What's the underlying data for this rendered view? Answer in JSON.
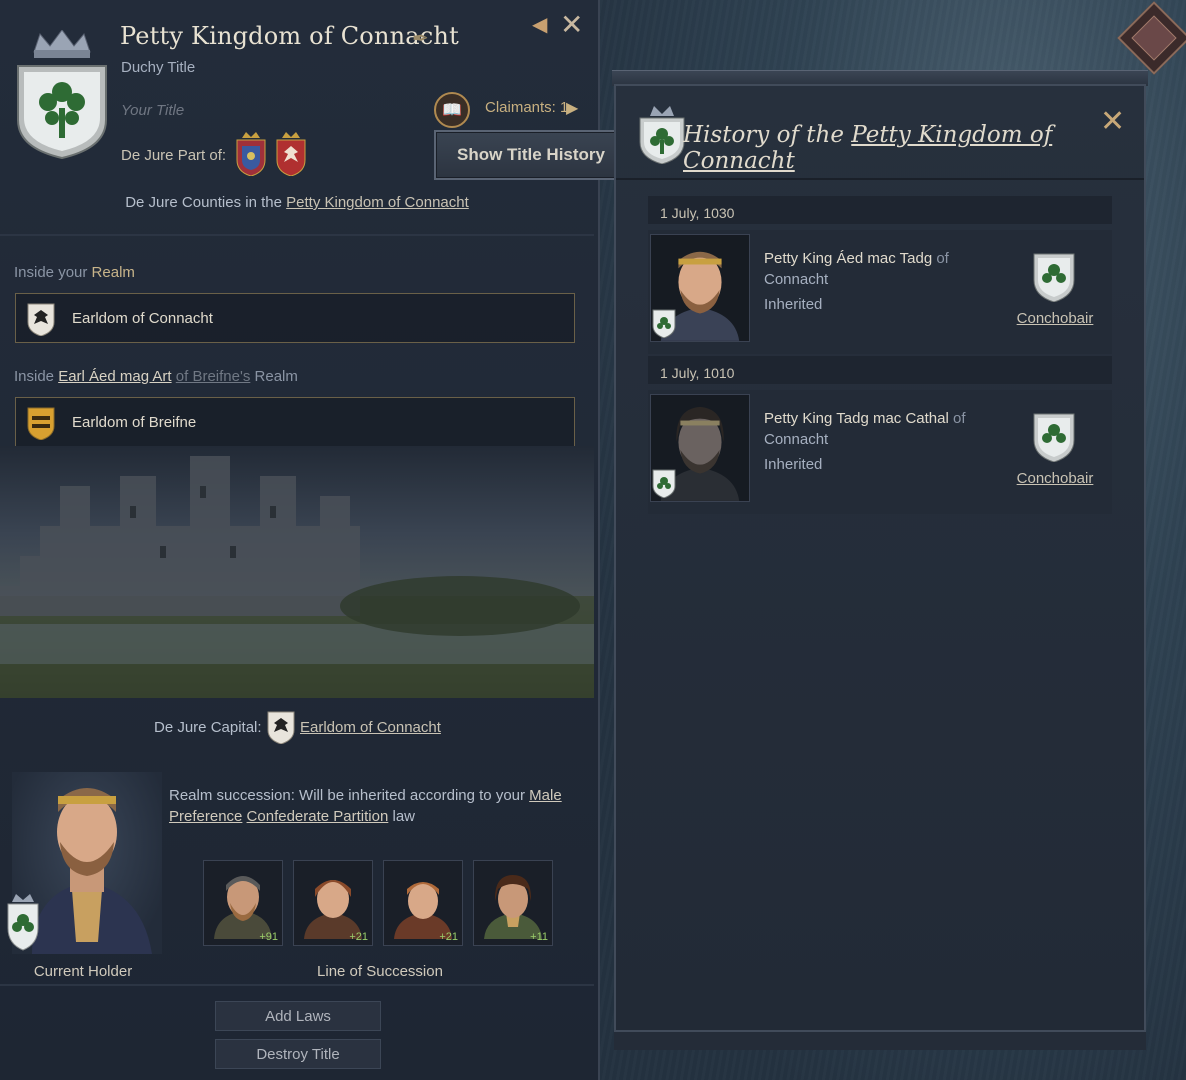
{
  "title_panel": {
    "title": "Petty Kingdom of Connacht",
    "subtitle": "Duchy Title",
    "your_title": "Your Title",
    "dejure_part_of_label": "De Jure Part of:",
    "claimants": "Claimants: 1",
    "show_history_button": "Show Title History",
    "dejure_counties_prefix": "De Jure Counties in the",
    "dejure_counties_link": "Petty Kingdom of Connacht",
    "inside_your": "Inside your",
    "realm_word": "Realm",
    "earldom_1": "Earldom of Connacht",
    "inside_prefix": "Inside",
    "inside_person": "Earl Áed mag Art",
    "inside_of": "of Breifne's",
    "inside_realm": "Realm",
    "earldom_2": "Earldom of Breifne",
    "capital_label": "De Jure Capital:",
    "capital_link": "Earldom of Connacht",
    "succession_prefix": "Realm succession: Will be inherited according to your",
    "succession_law_1": "Male Preference",
    "succession_law_2": "Confederate Partition",
    "succession_suffix": "law",
    "current_holder_label": "Current Holder",
    "line_of_succession_label": "Line of Succession",
    "heirs": [
      "+91",
      "+21",
      "+21",
      "+11"
    ],
    "add_laws_button": "Add Laws",
    "destroy_title_button": "Destroy Title"
  },
  "history_panel": {
    "title_prefix": "History of the",
    "title_link": "Petty Kingdom of Connacht",
    "entries": [
      {
        "date": "1 July, 1030",
        "name": "Petty King Áed mac Tadg",
        "of": "of",
        "location": "Connacht",
        "method": "Inherited",
        "dynasty": "Conchobair"
      },
      {
        "date": "1 July, 1010",
        "name": "Petty King Tadg mac Cathal",
        "of": "of",
        "location": "Connacht",
        "method": "Inherited",
        "dynasty": "Conchobair"
      }
    ]
  },
  "colors": {
    "crest_green": "#2e6b34",
    "crest_bg": "#e8ecec",
    "accent_gold": "#c8a070",
    "heir_score_green": "#9acd6a"
  }
}
